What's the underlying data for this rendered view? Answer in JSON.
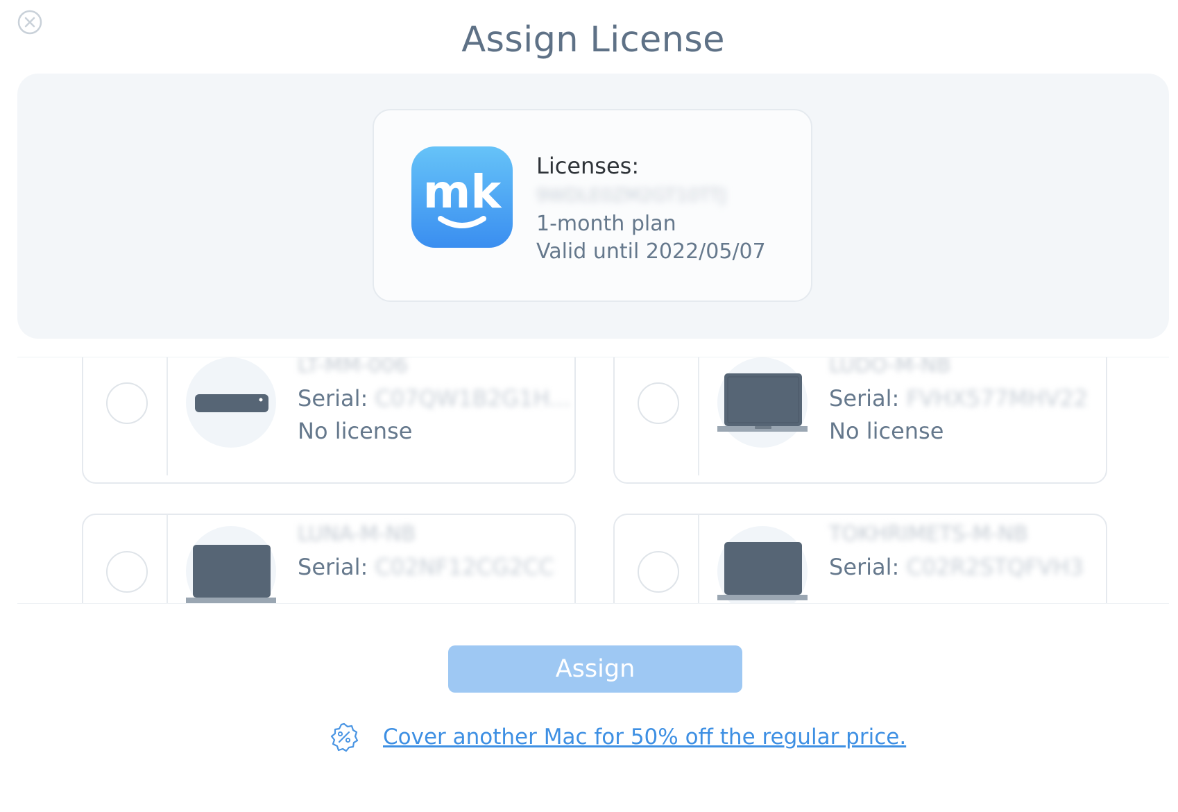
{
  "dialog": {
    "title": "Assign License"
  },
  "license": {
    "label": "Licenses:",
    "key": "9WDLE0ZM2GT10TTJ",
    "plan": "1-month plan",
    "valid_until": "Valid until 2022/05/07",
    "app_icon_text": "mk"
  },
  "devices": [
    {
      "name": "LT-MM-006",
      "serial_label": "Serial:",
      "serial": "C07QW1B2G1H...",
      "status": "No license",
      "icon": "mac-mini-icon"
    },
    {
      "name": "LUDO-M-NB",
      "serial_label": "Serial:",
      "serial": "FVHX577MHV22",
      "status": "No license",
      "icon": "laptop-icon"
    },
    {
      "name": "LUNA-M-NB",
      "serial_label": "Serial:",
      "serial": "C02NF12CG2CC",
      "status": "",
      "icon": "laptop-icon"
    },
    {
      "name": "TOKHRIMETS-M-NB",
      "serial_label": "Serial:",
      "serial": "C02R2STQFVH3",
      "status": "",
      "icon": "laptop-icon"
    }
  ],
  "actions": {
    "assign_label": "Assign"
  },
  "promo": {
    "text": "Cover another Mac for 50% off the regular price."
  },
  "colors": {
    "accent": "#3d8fe3",
    "button_disabled": "#9ec8f3",
    "text_muted": "#65788c",
    "panel_bg": "#f3f6f9"
  }
}
